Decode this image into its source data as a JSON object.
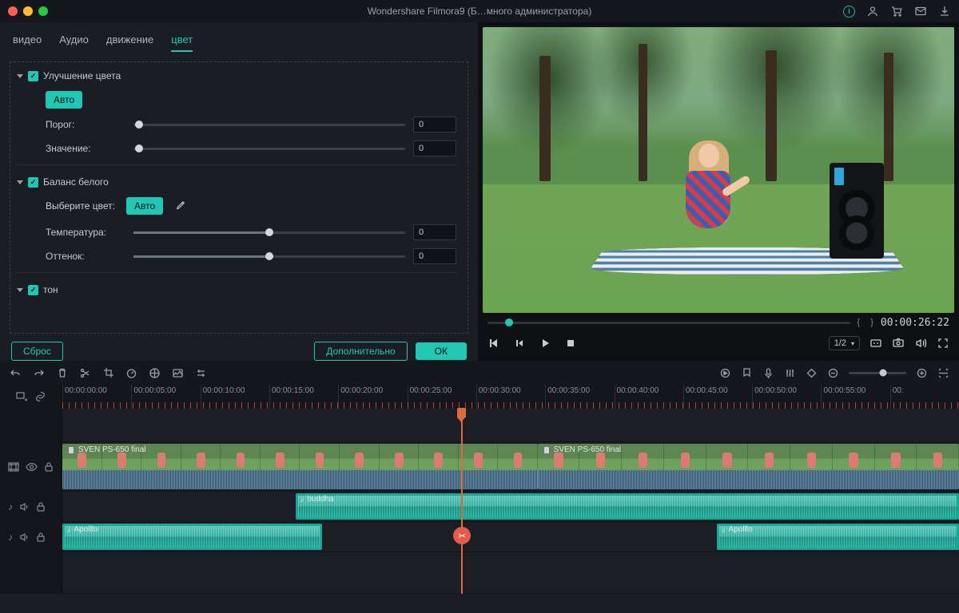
{
  "titlebar": {
    "title": "Wondershare Filmora9 (Б…много администратора)"
  },
  "tabs": {
    "video": "видео",
    "audio": "Аудио",
    "motion": "движение",
    "color": "цвет"
  },
  "color_panel": {
    "enhance": {
      "title": "Улучшение цвета",
      "auto": "Авто",
      "threshold_label": "Порог:",
      "threshold_value": "0",
      "value_label": "Значение:",
      "value_value": "0"
    },
    "white_balance": {
      "title": "Баланс белого",
      "pick_label": "Выберите цвет:",
      "auto": "Авто",
      "temperature_label": "Температура:",
      "temperature_value": "0",
      "tint_label": "Оттенок:",
      "tint_value": "0"
    },
    "tone": {
      "title": "тон"
    }
  },
  "footer": {
    "reset": "Сброс",
    "advanced": "Дополнительно",
    "ok": "ОК"
  },
  "player": {
    "timecode": "00:00:26:22",
    "zoom": "1/2"
  },
  "ruler": [
    "00:00:00:00",
    "00:00:05:00",
    "00:00:10:00",
    "00:00:15:00",
    "00:00:20:00",
    "00:00:25:00",
    "00:00:30:00",
    "00:00:35:00",
    "00:00:40:00",
    "00:00:45:00",
    "00:00:50:00",
    "00:00:55:00",
    "00:"
  ],
  "clips": {
    "video1": "SVEN PS-650 final",
    "video2": "SVEN PS-650 final",
    "audio1": "buddha",
    "audio2a": "Apolllo",
    "audio2b": "Apolllo"
  }
}
